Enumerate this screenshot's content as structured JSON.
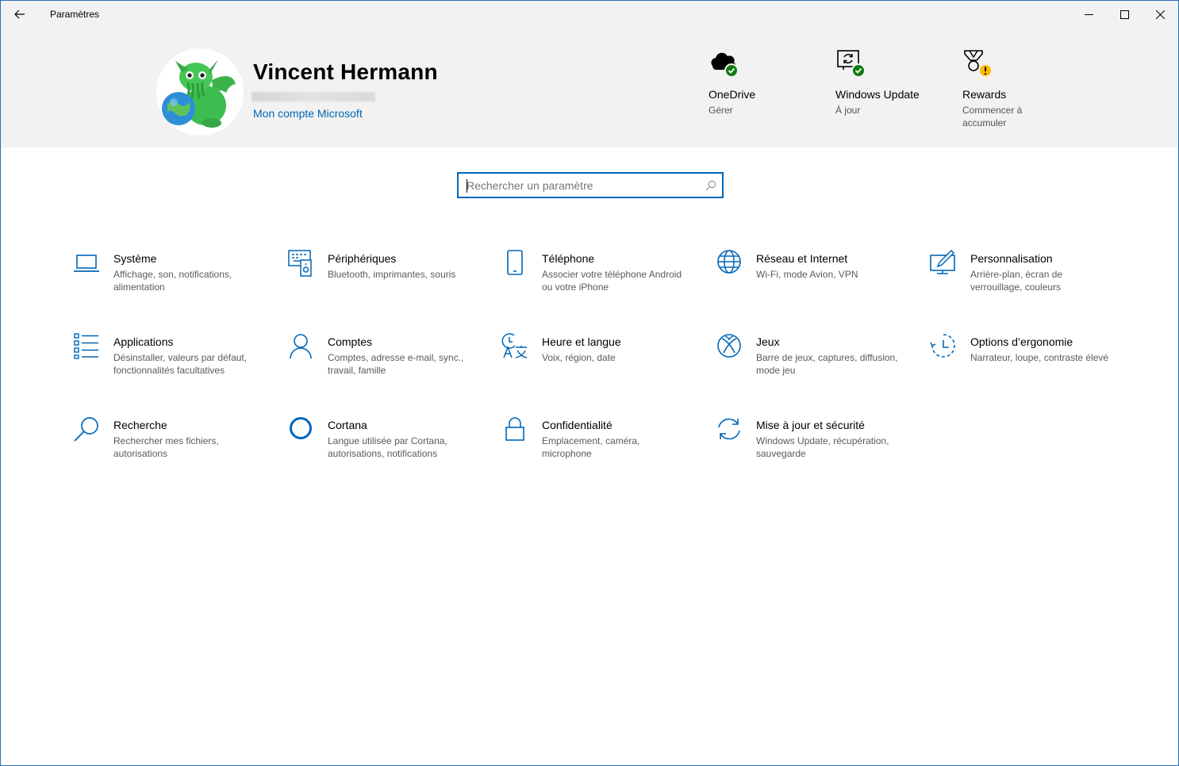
{
  "window": {
    "title": "Paramètres"
  },
  "header": {
    "user_name": "Vincent Hermann",
    "account_link": "Mon compte Microsoft",
    "quick_actions": [
      {
        "title": "OneDrive",
        "subtitle": "Gérer",
        "icon": "onedrive-icon",
        "status": "ok"
      },
      {
        "title": "Windows Update",
        "subtitle": "À jour",
        "icon": "windows-update-icon",
        "status": "ok"
      },
      {
        "title": "Rewards",
        "subtitle": "Commencer à accumuler",
        "icon": "rewards-icon",
        "status": "warning"
      }
    ]
  },
  "search": {
    "placeholder": "Rechercher un paramètre"
  },
  "categories": [
    {
      "title": "Système",
      "desc": "Affichage, son, notifications, alimentation",
      "icon": "laptop-icon"
    },
    {
      "title": "Périphériques",
      "desc": "Bluetooth, imprimantes, souris",
      "icon": "devices-icon"
    },
    {
      "title": "Téléphone",
      "desc": "Associer votre téléphone Android ou votre iPhone",
      "icon": "phone-icon"
    },
    {
      "title": "Réseau et Internet",
      "desc": "Wi-Fi, mode Avion, VPN",
      "icon": "globe-icon"
    },
    {
      "title": "Personnalisation",
      "desc": "Arrière-plan, écran de verrouillage, couleurs",
      "icon": "personalization-icon"
    },
    {
      "title": "Applications",
      "desc": "Désinstaller, valeurs par défaut, fonctionnalités facultatives",
      "icon": "apps-list-icon"
    },
    {
      "title": "Comptes",
      "desc": "Comptes, adresse e-mail, sync., travail, famille",
      "icon": "person-icon"
    },
    {
      "title": "Heure et langue",
      "desc": "Voix, région, date",
      "icon": "time-language-icon"
    },
    {
      "title": "Jeux",
      "desc": "Barre de jeux, captures, diffusion, mode jeu",
      "icon": "xbox-icon"
    },
    {
      "title": "Options d’ergonomie",
      "desc": "Narrateur, loupe, contraste élevé",
      "icon": "ease-of-access-icon"
    },
    {
      "title": "Recherche",
      "desc": "Rechercher mes fichiers, autorisations",
      "icon": "search-icon"
    },
    {
      "title": "Cortana",
      "desc": "Langue utilisée par Cortana, autorisations, notifications",
      "icon": "cortana-icon"
    },
    {
      "title": "Confidentialité",
      "desc": "Emplacement, caméra, microphone",
      "icon": "lock-icon"
    },
    {
      "title": "Mise à jour et sécurité",
      "desc": "Windows Update, récupération, sauvegarde",
      "icon": "update-sync-icon"
    }
  ],
  "colors": {
    "accent": "#0067b8",
    "header_bg": "#f2f2f2",
    "ok": "#107c10",
    "warning": "#ffb900"
  }
}
